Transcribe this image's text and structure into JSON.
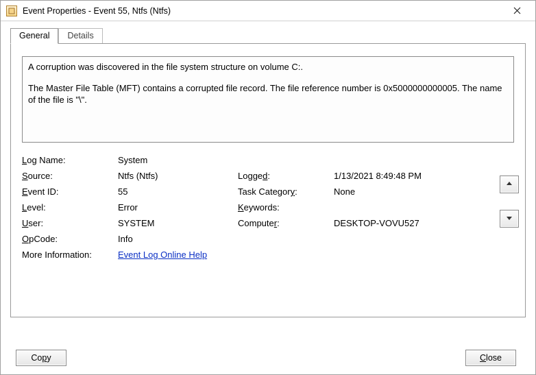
{
  "window": {
    "title": "Event Properties - Event 55, Ntfs (Ntfs)"
  },
  "tabs": {
    "general": "General",
    "details": "Details"
  },
  "description": {
    "line1": "A corruption was discovered in the file system structure on volume C:.",
    "line2": "The Master File Table (MFT) contains a corrupted file record.  The file reference number is 0x5000000000005.  The name of the file is \"\\\"."
  },
  "labels": {
    "log_name": "Log Name:",
    "source": "Source:",
    "event_id": "Event ID:",
    "level": "Level:",
    "user": "User:",
    "opcode": "OpCode:",
    "more_info": "More Information:",
    "logged": "Logged:",
    "task_category": "Task Category:",
    "keywords": "Keywords:",
    "computer": "Computer:"
  },
  "values": {
    "log_name": "System",
    "source": "Ntfs (Ntfs)",
    "event_id": "55",
    "level": "Error",
    "user": "SYSTEM",
    "opcode": "Info",
    "logged": "1/13/2021 8:49:48 PM",
    "task_category": "None",
    "keywords": "",
    "computer": "DESKTOP-VOVU527",
    "more_info_link": "Event Log Online Help"
  },
  "buttons": {
    "copy": "Copy",
    "close": "Close"
  }
}
